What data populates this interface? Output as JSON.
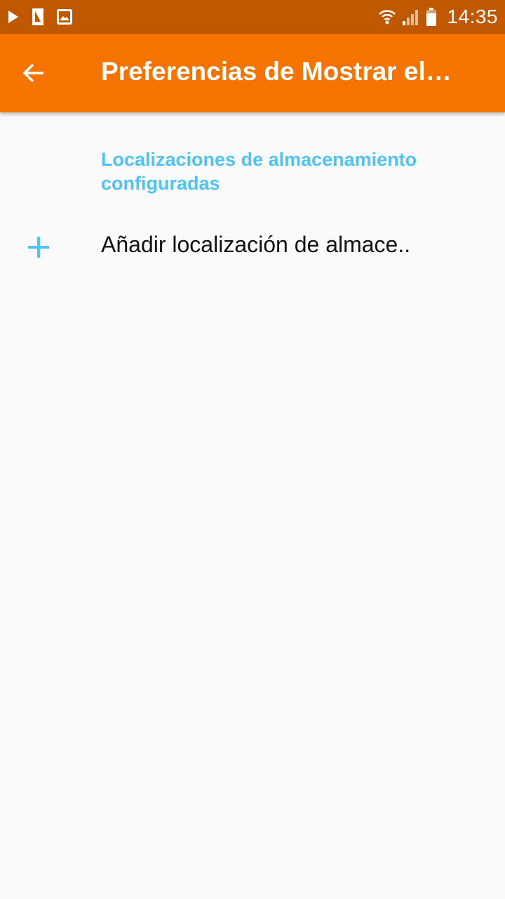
{
  "status_bar": {
    "time": "14:35",
    "icons": [
      "play-icon",
      "sim-card-icon",
      "image-icon",
      "wifi-icon",
      "signal-icon",
      "battery-icon"
    ]
  },
  "app_bar": {
    "title": "Preferencias de Mostrar el…",
    "back_icon": "arrow-back-icon",
    "color": "#F57400"
  },
  "content": {
    "section_header": "Localizaciones de almacenamiento configuradas",
    "add_item": {
      "label": "Añadir localización de almace..",
      "icon": "plus-icon"
    }
  },
  "colors": {
    "status_bar": "#BF5800",
    "accent": "#4FC3F7",
    "background": "#FAFAFA"
  }
}
